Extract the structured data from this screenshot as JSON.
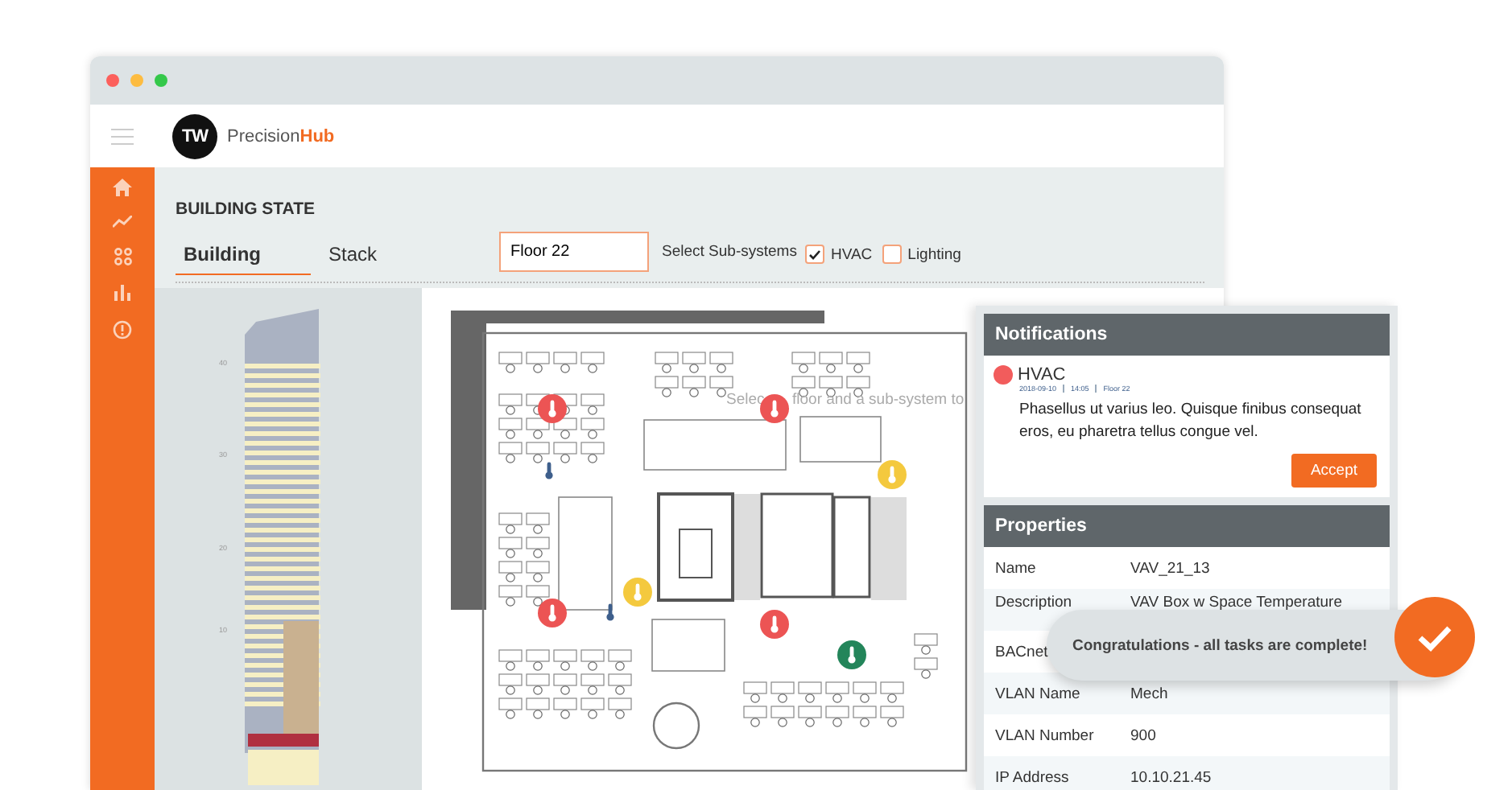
{
  "window": {
    "controls": [
      {
        "color": "#fc605c"
      },
      {
        "color": "#fdbc40"
      },
      {
        "color": "#34c84a"
      }
    ]
  },
  "app": {
    "logo_initials": "TW",
    "brand": "Precision**Hub**"
  },
  "page_title": "BUILDING STATE",
  "tabs": [
    {
      "label": "Building",
      "selected": true
    },
    {
      "label": "Stack",
      "selected": false
    }
  ],
  "floor_field": {
    "value": "Floor 22"
  },
  "subsystems": {
    "label": "Select Sub-systems",
    "options": [
      {
        "label": "HVAC",
        "checked": true
      },
      {
        "label": "Lighting",
        "checked": false
      }
    ]
  },
  "tower": {
    "floor_labels": [
      "40",
      "30",
      "20",
      "10"
    ]
  },
  "floor_plan": {
    "hint_fragments": [
      "Selec",
      "floor and a sub-system to"
    ],
    "pins": [
      {
        "kind": "alarm",
        "color": "#ec5454"
      },
      {
        "kind": "alarm",
        "color": "#ec5454"
      },
      {
        "kind": "alarm",
        "color": "#f4c93e"
      },
      {
        "kind": "alarm",
        "color": "#f4c93e"
      },
      {
        "kind": "alarm",
        "color": "#ec5454"
      },
      {
        "kind": "alarm",
        "color": "#ec5454"
      },
      {
        "kind": "alarm",
        "color": "#23855a"
      },
      {
        "kind": "sensor",
        "color": "#3e5f8c"
      },
      {
        "kind": "sensor",
        "color": "#3e5f8c"
      }
    ]
  },
  "notifications": {
    "title": "Notifications",
    "items": [
      {
        "color": "#f25c5c",
        "title": "HVAC",
        "date": "2018-09-10",
        "time": "14:05",
        "floor": "Floor 22",
        "message": "Phasellus ut varius leo. Quisque finibus consequat eros, eu pharetra tellus congue vel.",
        "action": "Accept"
      }
    ]
  },
  "properties": {
    "title": "Properties",
    "rows": [
      {
        "name": "Name",
        "value": "VAV_21_13"
      },
      {
        "name": "Description",
        "value": "VAV Box w Space Temperature"
      },
      {
        "name": "BACnet"
      },
      {
        "name": "VLAN Name",
        "value": "Mech"
      },
      {
        "name": "VLAN Number",
        "value": "900"
      },
      {
        "name": "IP Address",
        "value": "10.10.21.45"
      }
    ]
  },
  "toast": {
    "message": "Congratulations - all tasks are complete!"
  }
}
